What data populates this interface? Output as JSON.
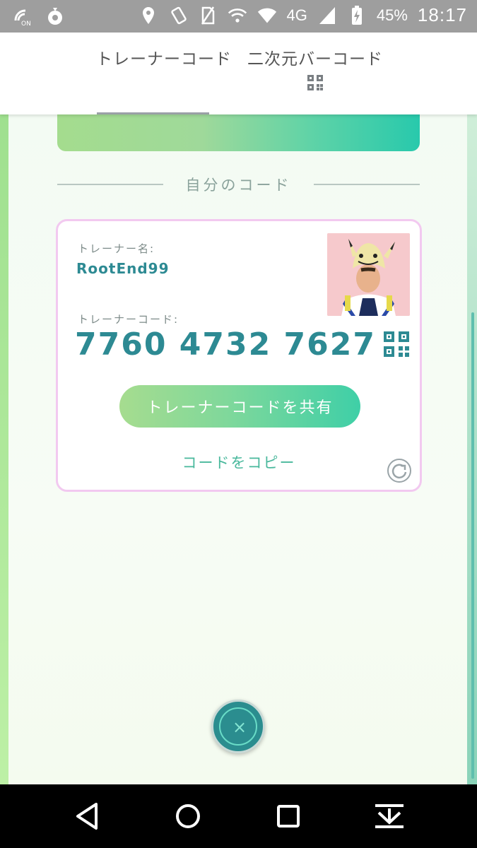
{
  "status_bar": {
    "network_type": "4G",
    "battery_percent": "45%",
    "time": "18:17",
    "icons": [
      "volte-icon",
      "pokemon-plus-icon",
      "location-icon",
      "vibrate-icon",
      "no-sim-icon",
      "wifi-call-icon",
      "wifi-icon",
      "signal-icon",
      "battery-charging-icon"
    ]
  },
  "tabs": {
    "trainer_code": "トレーナーコード",
    "qr_code": "二次元バーコード",
    "active": "trainer_code"
  },
  "section": {
    "title": "自分のコード"
  },
  "card": {
    "name_label": "トレーナー名:",
    "name_value": "RootEnd99",
    "code_label": "トレーナーコード:",
    "code_value": "7760 4732 7627",
    "share_button": "トレーナーコードを共有",
    "copy_link": "コードをコピー",
    "icons": [
      "qr-code-icon",
      "refresh-icon",
      "avatar"
    ]
  },
  "close_button": {
    "symbol": "×"
  },
  "nav": {
    "icons": [
      "back-icon",
      "home-icon",
      "recents-icon",
      "notification-pull-icon"
    ]
  },
  "colors": {
    "accent": "#2d8a93",
    "card_border": "#f2c9f0",
    "button_gradient_start": "#a6dc8f",
    "button_gradient_end": "#3fcfa7",
    "status_bar": "#9e9e9e"
  }
}
